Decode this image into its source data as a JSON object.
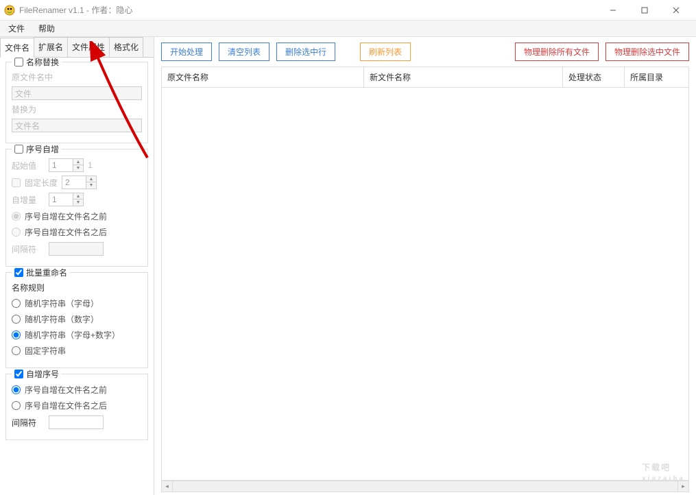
{
  "window": {
    "title": "FileRenamer v1.1 - 作者：隐心"
  },
  "menu": {
    "file": "文件",
    "help": "帮助"
  },
  "tabs": {
    "filename": "文件名",
    "ext": "扩展名",
    "attr": "文件属性",
    "format": "格式化"
  },
  "replace": {
    "legend": "名称替换",
    "field1_label": "原文件名中",
    "field1_value": "文件",
    "field2_label": "替换为",
    "field2_value": "文件名"
  },
  "autoinc": {
    "legend": "序号自增",
    "start_label": "起始值",
    "start_value": "1",
    "start_suffix": "1",
    "fixedlen_label": "固定长度",
    "fixedlen_value": "2",
    "step_label": "自增量",
    "step_value": "1",
    "pos_before": "序号自增在文件名之前",
    "pos_after": "序号自增在文件名之后",
    "sep_label": "间隔符"
  },
  "batch": {
    "legend": "批量重命名",
    "rule_label": "名称规则",
    "opt_alpha": "随机字符串（字母）",
    "opt_digit": "随机字符串（数字）",
    "opt_alnum": "随机字符串（字母+数字）",
    "opt_fixed": "固定字符串"
  },
  "incseq": {
    "legend": "自增序号",
    "pos_before": "序号自增在文件名之前",
    "pos_after": "序号自增在文件名之后",
    "sep_label": "间隔符"
  },
  "toolbar": {
    "start": "开始处理",
    "clear": "清空列表",
    "delsel": "删除选中行",
    "refresh": "刷新列表",
    "hard_del_all": "物理删除所有文件",
    "hard_del_sel": "物理删除选中文件"
  },
  "table": {
    "col1": "原文件名称",
    "col2": "新文件名称",
    "col3": "处理状态",
    "col4": "所属目录"
  },
  "watermark": {
    "main": "下载吧",
    "sub": "xiazaiba"
  }
}
